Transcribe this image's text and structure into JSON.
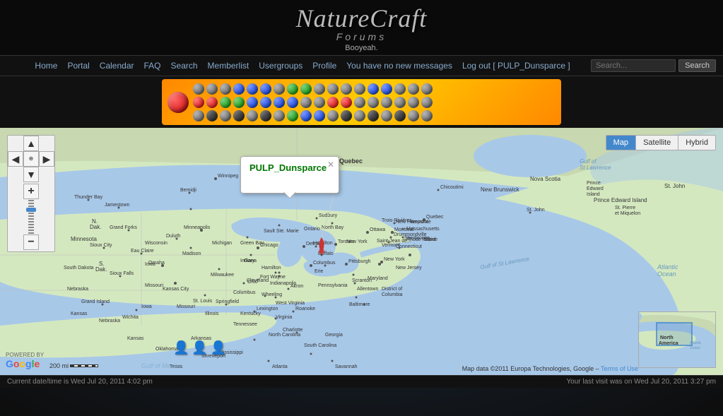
{
  "site": {
    "title": "NatureCraft",
    "subtitle": "Forums",
    "greeting": "Booyeah."
  },
  "navbar": {
    "links": [
      {
        "label": "Home",
        "id": "home"
      },
      {
        "label": "Portal",
        "id": "portal"
      },
      {
        "label": "Calendar",
        "id": "calendar"
      },
      {
        "label": "FAQ",
        "id": "faq"
      },
      {
        "label": "Search",
        "id": "search"
      },
      {
        "label": "Memberlist",
        "id": "memberlist"
      },
      {
        "label": "Usergroups",
        "id": "usergroups"
      },
      {
        "label": "Profile",
        "id": "profile"
      },
      {
        "label": "You have no new messages",
        "id": "messages"
      },
      {
        "label": "Log out [ PULP_Dunsparce ]",
        "id": "logout"
      }
    ],
    "search_placeholder": "Search...",
    "search_button": "Search"
  },
  "map": {
    "popup_username": "PULP_Dunsparce",
    "type_buttons": [
      "Map",
      "Satellite",
      "Hybrid"
    ],
    "active_type": "Map",
    "credit_text": "Map data ©2011 Europa Technologies, Google –",
    "credit_link": "Terms of Use",
    "scale_text": "200 mi",
    "mini_map_label": "North America",
    "mini_map_ocean": "Atlantic Ocean"
  },
  "footer": {
    "left": "Current date/time is Wed Jul 20, 2011 4:02 pm",
    "right": "Your last visit was on Wed Jul 20, 2011 3:27 pm"
  }
}
